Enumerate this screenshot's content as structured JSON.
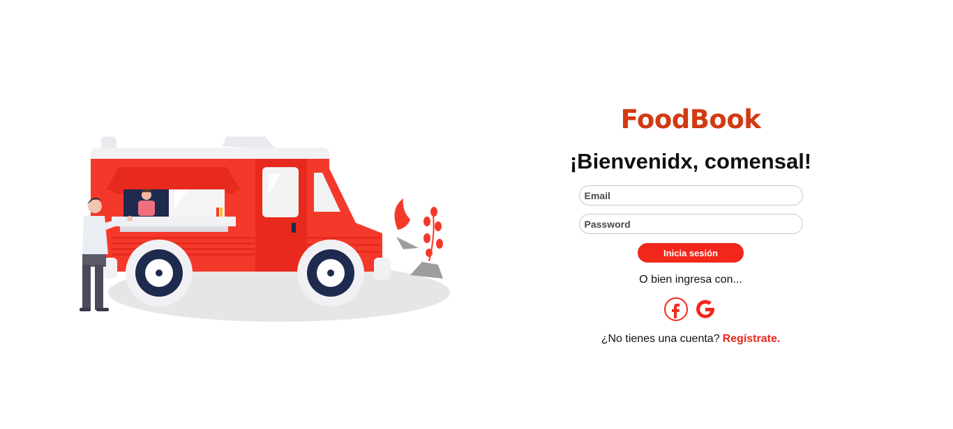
{
  "brand": {
    "name": "FoodBook",
    "color": "#d13a12"
  },
  "welcome": {
    "title": "¡Bienvenidx, comensal!"
  },
  "form": {
    "email_placeholder": "Email",
    "password_placeholder": "Password",
    "login_label": "Inicia sesión"
  },
  "social": {
    "prompt": "O bien ingresa con...",
    "providers": [
      {
        "name": "facebook-icon"
      },
      {
        "name": "google-icon"
      }
    ]
  },
  "signup": {
    "question": "¿No tienes una cuenta?",
    "link_label": "Regístrate."
  },
  "colors": {
    "accent": "#f3261b",
    "truck": "#f4392b",
    "wheel": "#1f2a4f"
  }
}
